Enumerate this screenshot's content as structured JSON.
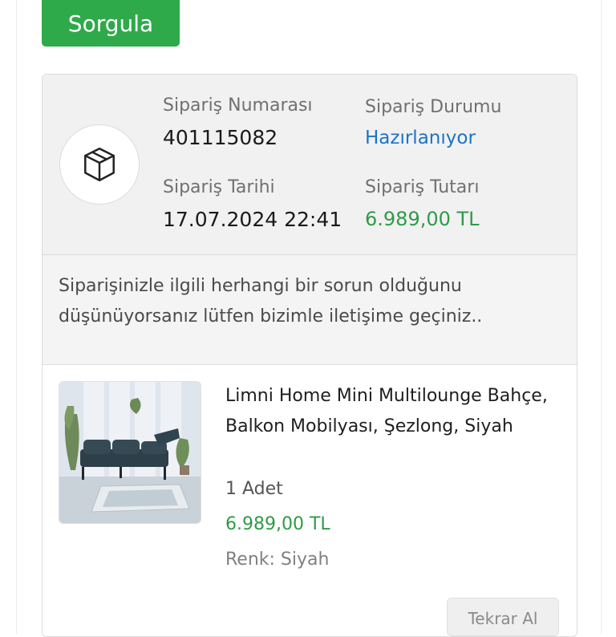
{
  "actions": {
    "query_label": "Sorgula"
  },
  "order": {
    "number_label": "Sipariş Numarası",
    "number": "401115082",
    "status_label": "Sipariş Durumu",
    "status": "Hazırlanıyor",
    "date_label": "Sipariş Tarihi",
    "date": "17.07.2024 22:41",
    "total_label": "Sipariş Tutarı",
    "total": "6.989,00 TL",
    "icon": "package-box-icon"
  },
  "notice": {
    "text": "Siparişinizle ilgili herhangi bir sorun olduğunu düşünüyorsanız lütfen bizimle iletişime geçiniz.."
  },
  "product": {
    "name": "Limni Home Mini Multilounge Bahçe, Balkon Mobilyası, Şezlong, Siyah",
    "quantity": "1 Adet",
    "price": "6.989,00 TL",
    "color": "Renk: Siyah",
    "reorder_label": "Tekrar Al"
  },
  "colors": {
    "primary_green": "#2eaa4a",
    "price_green": "#2e9b46",
    "status_blue": "#1a73c8",
    "header_bg": "#f1f1f1"
  }
}
